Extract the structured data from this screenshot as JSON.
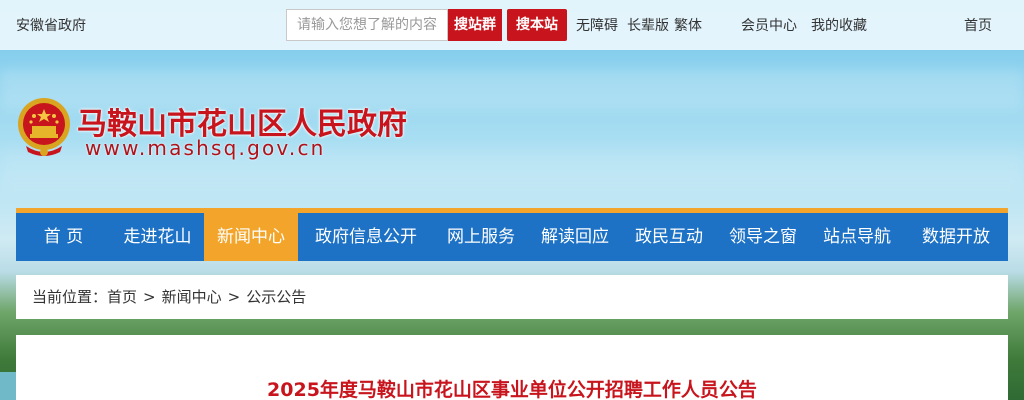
{
  "topbar": {
    "province": "安徽省政府",
    "search_placeholder": "请输入您想了解的内容",
    "search_group_label": "搜站群",
    "search_site_label": "搜本站",
    "links": [
      "无障碍",
      "长辈版",
      "繁体",
      "会员中心",
      "我的收藏",
      "首页"
    ]
  },
  "header": {
    "title": "马鞍山市花山区人民政府",
    "url": "www.mashsq.gov.cn"
  },
  "nav": {
    "items": [
      "首 页",
      "走进花山",
      "新闻中心",
      "政府信息公开",
      "网上服务",
      "解读回应",
      "政民互动",
      "领导之窗",
      "站点导航",
      "数据开放"
    ],
    "active_index": 2
  },
  "breadcrumb": {
    "label": "当前位置：",
    "items": [
      "首页",
      "新闻中心",
      "公示公告"
    ],
    "separator": ">"
  },
  "article": {
    "title": "2025年度马鞍山市花山区事业单位公开招聘工作人员公告"
  },
  "colors": {
    "brand_red": "#c8151d",
    "nav_blue": "#1d72c5",
    "nav_active": "#f2a52a"
  }
}
